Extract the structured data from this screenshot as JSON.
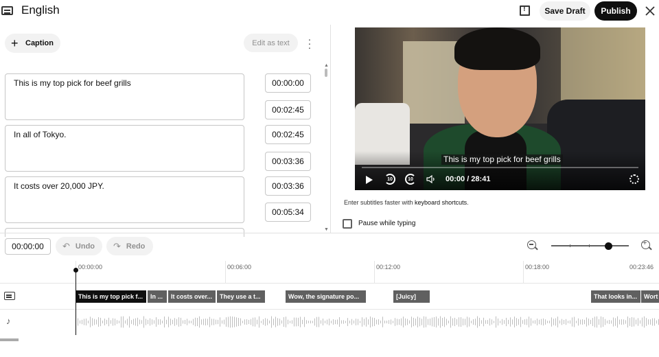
{
  "header": {
    "language": "English",
    "save_draft": "Save Draft",
    "publish": "Publish"
  },
  "editor": {
    "add_caption": "Caption",
    "edit_as_text": "Edit as text",
    "cues": [
      {
        "text": "This is my top pick for beef grills",
        "start": "00:00:00",
        "end": "00:02:45"
      },
      {
        "text": "In all of Tokyo.",
        "start": "00:02:45",
        "end": "00:03:36"
      },
      {
        "text": "It costs over 20,000 JPY.",
        "start": "00:03:36",
        "end": "00:05:34"
      }
    ]
  },
  "video": {
    "subtitle": "This is my top pick for beef grills",
    "time": "00:00 / 28:41",
    "skip_back": "10",
    "skip_forward": "10"
  },
  "hints": {
    "keyboard_prefix": "Enter subtitles faster with ",
    "keyboard_link": "keyboard shortcuts",
    "keyboard_suffix": ".",
    "pause_while_typing": "Pause while typing"
  },
  "toolbar": {
    "current_time": "00:00:00",
    "undo": "Undo",
    "redo": "Redo",
    "zoom_level": 0.75
  },
  "timeline": {
    "ruler": [
      "00:00:00",
      "00:06:00",
      "00:12:00",
      "00:18:00",
      "00:23:46"
    ],
    "blocks": [
      {
        "label": "This is my top pick f..."
      },
      {
        "label": "In ..."
      },
      {
        "label": "It costs over..."
      },
      {
        "label": "They use a t..."
      },
      {
        "label": "Wow, the signature po..."
      },
      {
        "label": "[Juicy]"
      },
      {
        "label": "That looks in..."
      },
      {
        "label": "Wort"
      }
    ]
  },
  "colors": {
    "accent": "#0f0f0f",
    "button_bg": "#f2f2f2",
    "block": "#606060"
  }
}
